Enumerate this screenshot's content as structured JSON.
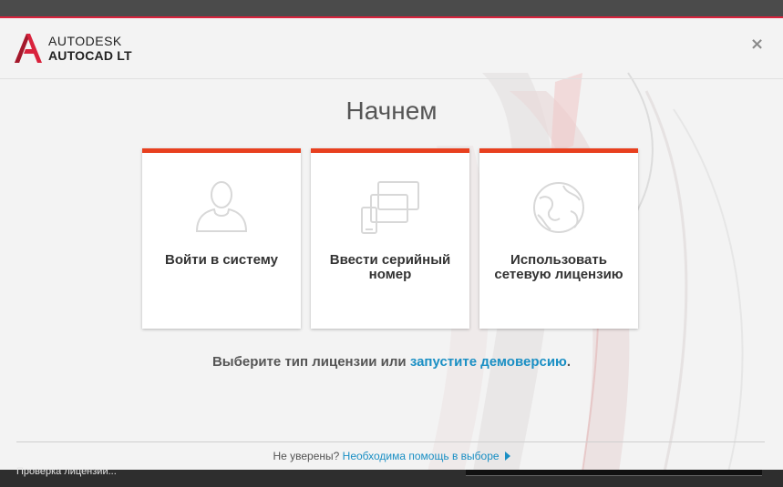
{
  "app": {
    "brand_top": "AUTODESK",
    "brand_bottom": "AUTOCAD LT",
    "close_glyph": "×"
  },
  "page": {
    "title": "Начнем"
  },
  "cards": [
    {
      "label": "Войти в систему",
      "icon": "user-silhouette-icon"
    },
    {
      "label": "Ввести серийный номер",
      "icon": "devices-icon"
    },
    {
      "label": "Использовать сетевую лицензию",
      "icon": "network-globe-icon"
    }
  ],
  "hint": {
    "prefix": "Выберите тип лицензии или ",
    "link": "запустите демоверсию",
    "suffix": "."
  },
  "footer": {
    "prefix": "Не уверены? ",
    "link": "Необходима помощь в выборе"
  },
  "taskbar": {
    "status": "Проверка лицензии..."
  },
  "colors": {
    "accent": "#e8401f",
    "brand_red": "#d9223c",
    "link": "#1a8fc4"
  }
}
